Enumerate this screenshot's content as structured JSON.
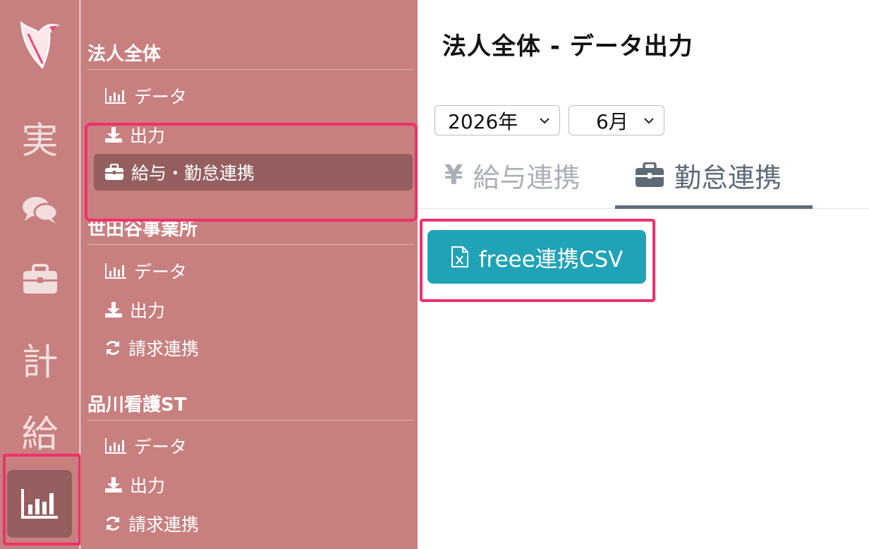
{
  "rail": {
    "items": [
      {
        "label": "実"
      },
      {
        "icon": "chat-icon"
      },
      {
        "icon": "briefcase-icon"
      },
      {
        "label": "計"
      },
      {
        "label": "給"
      },
      {
        "icon": "bar-chart-icon",
        "active": true
      }
    ]
  },
  "nav": {
    "groups": [
      {
        "title": "法人全体",
        "items": [
          {
            "icon": "bar-chart-icon",
            "label": "データ"
          },
          {
            "icon": "download-icon",
            "label": "出力"
          },
          {
            "icon": "briefcase-icon",
            "label": "給与・勤怠連携",
            "active": true
          }
        ]
      },
      {
        "title": "世田谷事業所",
        "items": [
          {
            "icon": "bar-chart-icon",
            "label": "データ"
          },
          {
            "icon": "download-icon",
            "label": "出力"
          },
          {
            "icon": "refresh-icon",
            "label": "請求連携"
          }
        ]
      },
      {
        "title": "品川看護ST",
        "items": [
          {
            "icon": "bar-chart-icon",
            "label": "データ"
          },
          {
            "icon": "download-icon",
            "label": "出力"
          },
          {
            "icon": "refresh-icon",
            "label": "請求連携"
          }
        ]
      }
    ]
  },
  "main": {
    "title": "法人全体 - データ出力",
    "year_select": {
      "value": "2026年"
    },
    "month_select": {
      "value": "6月"
    },
    "tabs": [
      {
        "icon": "yen-icon",
        "icon_text": "¥",
        "label": "給与連携",
        "active": false
      },
      {
        "icon": "briefcase-icon",
        "label": "勤怠連携",
        "active": true
      }
    ],
    "csv_button": {
      "icon": "excel-file-icon",
      "label": "freee連携CSV"
    }
  },
  "colors": {
    "sidebar": "#c87f7f",
    "sidebar_active": "#955f5f",
    "highlight": "#f0306a",
    "button": "#21a3b7",
    "tab_active": "#5e6a77",
    "tab_inactive": "#aab0b6"
  }
}
